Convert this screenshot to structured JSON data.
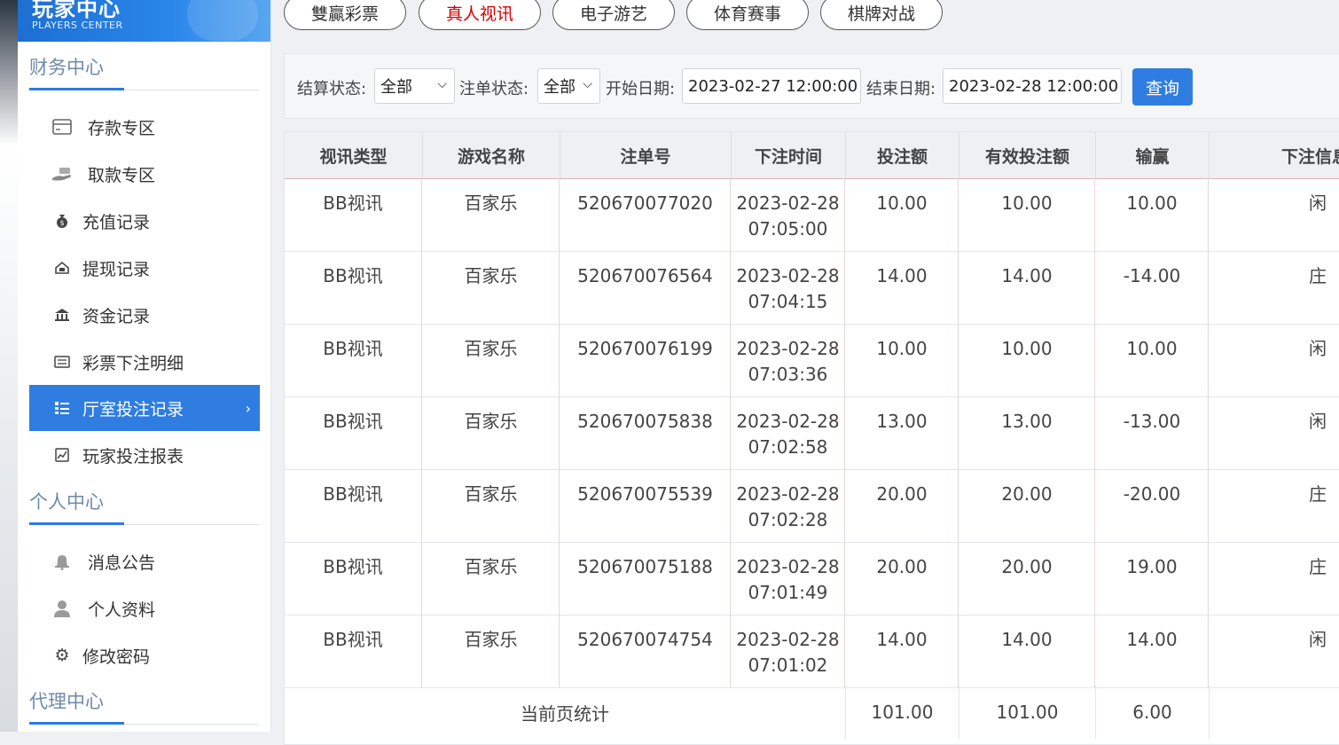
{
  "brand": {
    "title": "玩家中心",
    "subtitle": "PLAYERS CENTER"
  },
  "sidebar": {
    "sections": [
      {
        "title": "财务中心"
      },
      {
        "title": "个人中心"
      },
      {
        "title": "代理中心"
      }
    ],
    "finance_items": [
      {
        "label": "存款专区",
        "icon": "card-icon"
      },
      {
        "label": "取款专区",
        "icon": "hand-cash-icon"
      },
      {
        "label": "充值记录",
        "icon": "money-bag-icon"
      },
      {
        "label": "提现记录",
        "icon": "withdraw-icon"
      },
      {
        "label": "资金记录",
        "icon": "bank-icon"
      },
      {
        "label": "彩票下注明细",
        "icon": "list-icon"
      },
      {
        "label": "厅室投注记录",
        "icon": "grid-list-icon",
        "active": true
      },
      {
        "label": "玩家投注报表",
        "icon": "chart-icon"
      }
    ],
    "personal_items": [
      {
        "label": "消息公告",
        "icon": "bell-icon"
      },
      {
        "label": "个人资料",
        "icon": "user-icon"
      },
      {
        "label": "修改密码",
        "icon": "gear-icon"
      }
    ]
  },
  "tabs": [
    {
      "label": "雙贏彩票"
    },
    {
      "label": "真人视讯",
      "active": true
    },
    {
      "label": "电子游艺"
    },
    {
      "label": "体育赛事"
    },
    {
      "label": "棋牌对战"
    }
  ],
  "filter": {
    "settle_label": "结算状态:",
    "settle_value": "全部",
    "order_label": "注单状态:",
    "order_value": "全部",
    "start_label": "开始日期:",
    "start_value": "2023-02-27 12:00:00",
    "end_label": "结束日期:",
    "end_value": "2023-02-28 12:00:00",
    "query_label": "查询"
  },
  "table": {
    "headers": [
      "视讯类型",
      "游戏名称",
      "注单号",
      "下注时间",
      "投注额",
      "有效投注额",
      "输赢",
      "下注信息"
    ],
    "rows": [
      {
        "type": "BB视讯",
        "game": "百家乐",
        "order": "520670077020",
        "date": "2023-02-28",
        "time": "07:05:00",
        "bet": "10.00",
        "valid": "10.00",
        "win": "10.00",
        "info": "闲"
      },
      {
        "type": "BB视讯",
        "game": "百家乐",
        "order": "520670076564",
        "date": "2023-02-28",
        "time": "07:04:15",
        "bet": "14.00",
        "valid": "14.00",
        "win": "-14.00",
        "info": "庄"
      },
      {
        "type": "BB视讯",
        "game": "百家乐",
        "order": "520670076199",
        "date": "2023-02-28",
        "time": "07:03:36",
        "bet": "10.00",
        "valid": "10.00",
        "win": "10.00",
        "info": "闲"
      },
      {
        "type": "BB视讯",
        "game": "百家乐",
        "order": "520670075838",
        "date": "2023-02-28",
        "time": "07:02:58",
        "bet": "13.00",
        "valid": "13.00",
        "win": "-13.00",
        "info": "闲"
      },
      {
        "type": "BB视讯",
        "game": "百家乐",
        "order": "520670075539",
        "date": "2023-02-28",
        "time": "07:02:28",
        "bet": "20.00",
        "valid": "20.00",
        "win": "-20.00",
        "info": "庄"
      },
      {
        "type": "BB视讯",
        "game": "百家乐",
        "order": "520670075188",
        "date": "2023-02-28",
        "time": "07:01:49",
        "bet": "20.00",
        "valid": "20.00",
        "win": "19.00",
        "info": "庄"
      },
      {
        "type": "BB视讯",
        "game": "百家乐",
        "order": "520670074754",
        "date": "2023-02-28",
        "time": "07:01:02",
        "bet": "14.00",
        "valid": "14.00",
        "win": "14.00",
        "info": "闲"
      }
    ],
    "summary": {
      "label": "当前页统计",
      "bet": "101.00",
      "valid": "101.00",
      "win": "6.00"
    }
  }
}
